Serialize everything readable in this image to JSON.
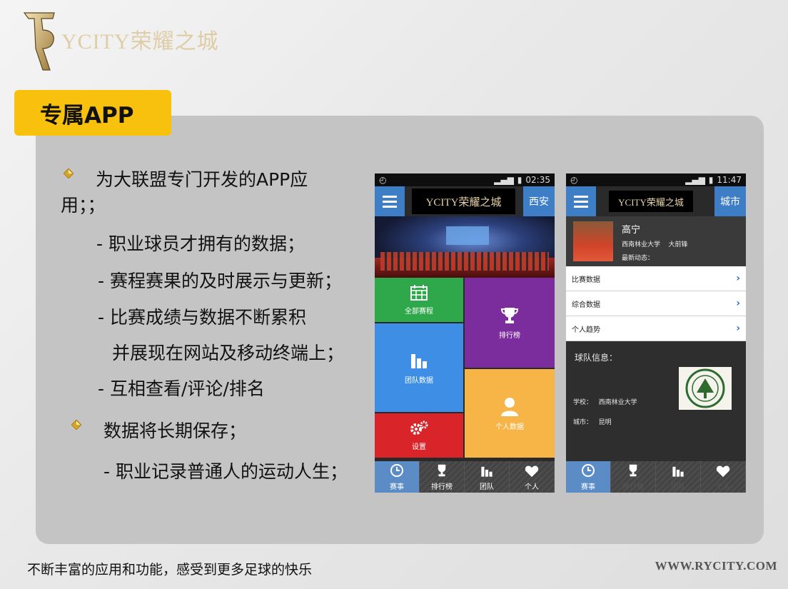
{
  "brand": {
    "logo_text": "YCITY荣耀之城"
  },
  "section_tag": "专属APP",
  "content": {
    "bullet1_line1": "为大联盟专门开发的APP应",
    "bullet1_line2": "用；；",
    "sub1": "-  职业球员才拥有的数据；",
    "sub2": "-  赛程赛果的及时展示与更新；",
    "sub3": "-  比赛成绩与数据不断累积",
    "sub3b": "并展现在网站及移动终端上；",
    "sub4": "-  互相查看/评论/排名",
    "bullet2": "数据将长期保存；",
    "sub5": "-  职业记录普通人的运动人生；"
  },
  "phone1": {
    "time": "02:35",
    "header_logo": "YCITY荣耀之城",
    "city": "西安",
    "tiles": {
      "all_matches": "全部赛程",
      "ranking": "排行榜",
      "team_data": "团队数据",
      "personal_data": "个人数据",
      "settings": "设置"
    },
    "tabs": [
      "赛事",
      "排行榜",
      "团队",
      "个人"
    ]
  },
  "phone2": {
    "time": "11:47",
    "header_logo": "YCITY荣耀之城",
    "city": "城市",
    "player_name": "高宁",
    "player_school": "西南林业大学",
    "player_position": "大前锋",
    "latest_label": "最新动态：",
    "links": [
      "比赛数据",
      "综合数据",
      "个人趋势"
    ],
    "team_info_label": "球队信息：",
    "school_label": "学校：",
    "school_value": "西南林业大学",
    "city_label": "城市：",
    "city_value": "昆明",
    "tabs": [
      "赛事",
      "排行榜",
      "团队",
      "个人"
    ]
  },
  "footer": {
    "left": "不断丰富的应用和功能，感受到更多足球的快乐",
    "right": "WWW.RYCITY.COM"
  },
  "colors": {
    "tag": "#f8c10d",
    "panel": "#c4c4c4",
    "green": "#2ea84a",
    "purple": "#7b2d9e",
    "blue": "#3d8ee4",
    "orange": "#f7b548",
    "red": "#d9252a",
    "header_blue": "#3d7ec7"
  }
}
